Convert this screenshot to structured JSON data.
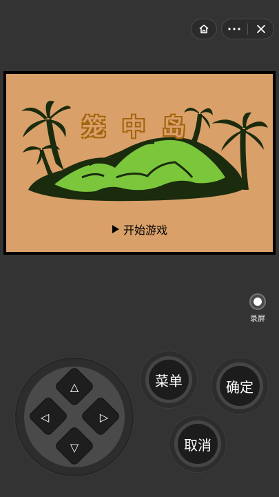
{
  "topbar": {
    "home_icon": "home-icon",
    "more_icon": "more-dots-icon",
    "close_icon": "close-icon"
  },
  "game": {
    "title_chars": [
      "笼",
      "中",
      "岛"
    ],
    "menu_option": "开始游戏",
    "colors": {
      "background": "#d9a069",
      "island_dark": "#1b2b0d",
      "island_light": "#7bc63b",
      "title_outline": "#e8c21b"
    }
  },
  "record": {
    "label": "录屏"
  },
  "dpad": {
    "up": "△",
    "down": "▽",
    "left": "◁",
    "right": "▷"
  },
  "buttons": {
    "menu": "菜单",
    "confirm": "确定",
    "cancel": "取消"
  }
}
